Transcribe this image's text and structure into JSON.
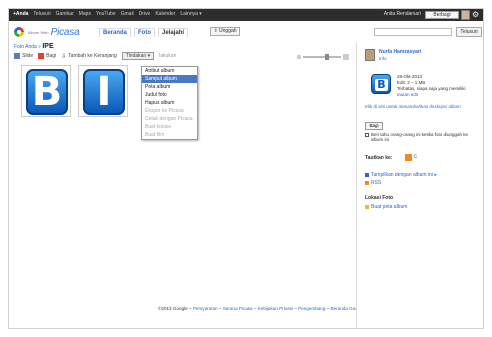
{
  "gbar": {
    "links": [
      "+Anda",
      "Telusuri",
      "Gambar",
      "Maps",
      "YouTube",
      "Gmail",
      "Drive",
      "Kalender",
      "Lainnya ▾"
    ],
    "user_name": "Anita Rendarsari",
    "share_label": "Berbagi",
    "gear": "⚙"
  },
  "header": {
    "logo_small": "Album Web",
    "logo_big": "Picasa",
    "tabs": [
      "Beranda",
      "Foto",
      "Jelajahi"
    ],
    "upload_label": "⇧ Unggah",
    "search_button": "Telusuri"
  },
  "main": {
    "breadcrumb_root": "Foto Anda",
    "breadcrumb_sep": " » ",
    "album_title": "IPE",
    "toolbar": {
      "slideshow": "Slide",
      "share": "Bagi",
      "download": "Tambah ke Keranjang",
      "actions": "Tindakan ▾",
      "extra": "lakukan"
    },
    "thumbs": [
      "B",
      "I"
    ],
    "menu_items": [
      {
        "label": "Atribut album",
        "state": "normal"
      },
      {
        "label": "Sampul album",
        "state": "selected"
      },
      {
        "label": "Peta album",
        "state": "normal"
      },
      {
        "label": "Judul foto",
        "state": "normal"
      },
      {
        "label": "Hapus album",
        "state": "normal"
      },
      {
        "label": "Ekspor ke Picasa",
        "state": "disabled"
      },
      {
        "label": "Cetak dengan Picasa",
        "state": "disabled"
      },
      {
        "label": "Buat kolase",
        "state": "disabled"
      },
      {
        "label": "Buat film",
        "state": "disabled"
      }
    ],
    "footer_first": "©2013 Google",
    "footer_links": [
      "Persyaratan",
      "Sarana Picasa",
      "Kebijakan Privasi",
      "Pengembang",
      "Beranda Google"
    ]
  },
  "side": {
    "user_name": "Nurfa Hamzasyari",
    "user_sub": "Info",
    "album_date": "28-Okt-2013",
    "album_size": "Edit: 2 – 1 MB",
    "album_vis": "Terbatas, siapa saja yang memiliki",
    "album_vis_link": "tautan edit",
    "caption": "Klik di sini untuk menambahkan deskripsi album",
    "share_btn": "Bagi",
    "share_check_label": "Beri tahu orang-orang ini ketika foto diunggah ke album ini",
    "links_header": "Tautkan ke:",
    "link_items": [
      "Tampilkan dengan album ini ▸",
      "RSS"
    ],
    "location_header": "Lokasi Foto",
    "location_link": "Buat peta album"
  }
}
